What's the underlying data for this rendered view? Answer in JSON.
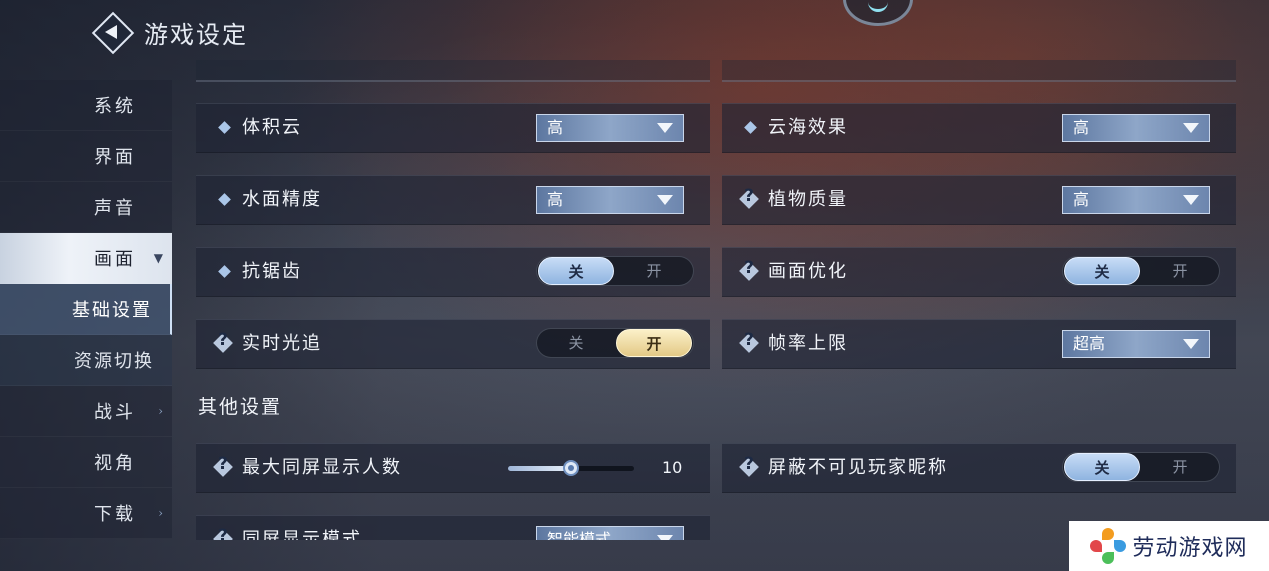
{
  "header": {
    "title": "游戏设定",
    "back_icon": "back-diamond-icon"
  },
  "sidebar": {
    "items": [
      {
        "label": "系统"
      },
      {
        "label": "界面"
      },
      {
        "label": "声音"
      },
      {
        "label": "画面",
        "expanded": true
      },
      {
        "label": "基础设置",
        "sub": true,
        "selected": true
      },
      {
        "label": "资源切换",
        "sub": true
      },
      {
        "label": "战斗",
        "has_arrow": true
      },
      {
        "label": "视角"
      },
      {
        "label": "下载",
        "has_arrow": true
      }
    ]
  },
  "settings": {
    "volumetric_clouds": {
      "label": "体积云",
      "value": "高"
    },
    "cloud_sea": {
      "label": "云海效果",
      "value": "高"
    },
    "water_precision": {
      "label": "水面精度",
      "value": "高"
    },
    "plant_quality": {
      "label": "植物质量",
      "value": "高"
    },
    "anti_aliasing": {
      "label": "抗锯齿",
      "off": "关",
      "on": "开",
      "state": "off"
    },
    "picture_optimization": {
      "label": "画面优化",
      "off": "关",
      "on": "开",
      "state": "off"
    },
    "ray_tracing": {
      "label": "实时光追",
      "off": "关",
      "on": "开",
      "state": "on"
    },
    "frame_rate_limit": {
      "label": "帧率上限",
      "value": "超高"
    }
  },
  "other_settings": {
    "title": "其他设置",
    "max_players": {
      "label": "最大同屏显示人数",
      "value": "10",
      "fraction": 0.5
    },
    "hide_nicknames": {
      "label": "屏蔽不可见玩家昵称",
      "off": "关",
      "on": "开",
      "state": "off"
    },
    "display_mode": {
      "label": "同屏显示模式",
      "value": "智能模式"
    }
  },
  "watermark": {
    "text": "劳动游戏网"
  },
  "colors": {
    "accent_off": "#8fb4e0",
    "accent_on": "#e3c986",
    "panel": "#1e2434"
  }
}
